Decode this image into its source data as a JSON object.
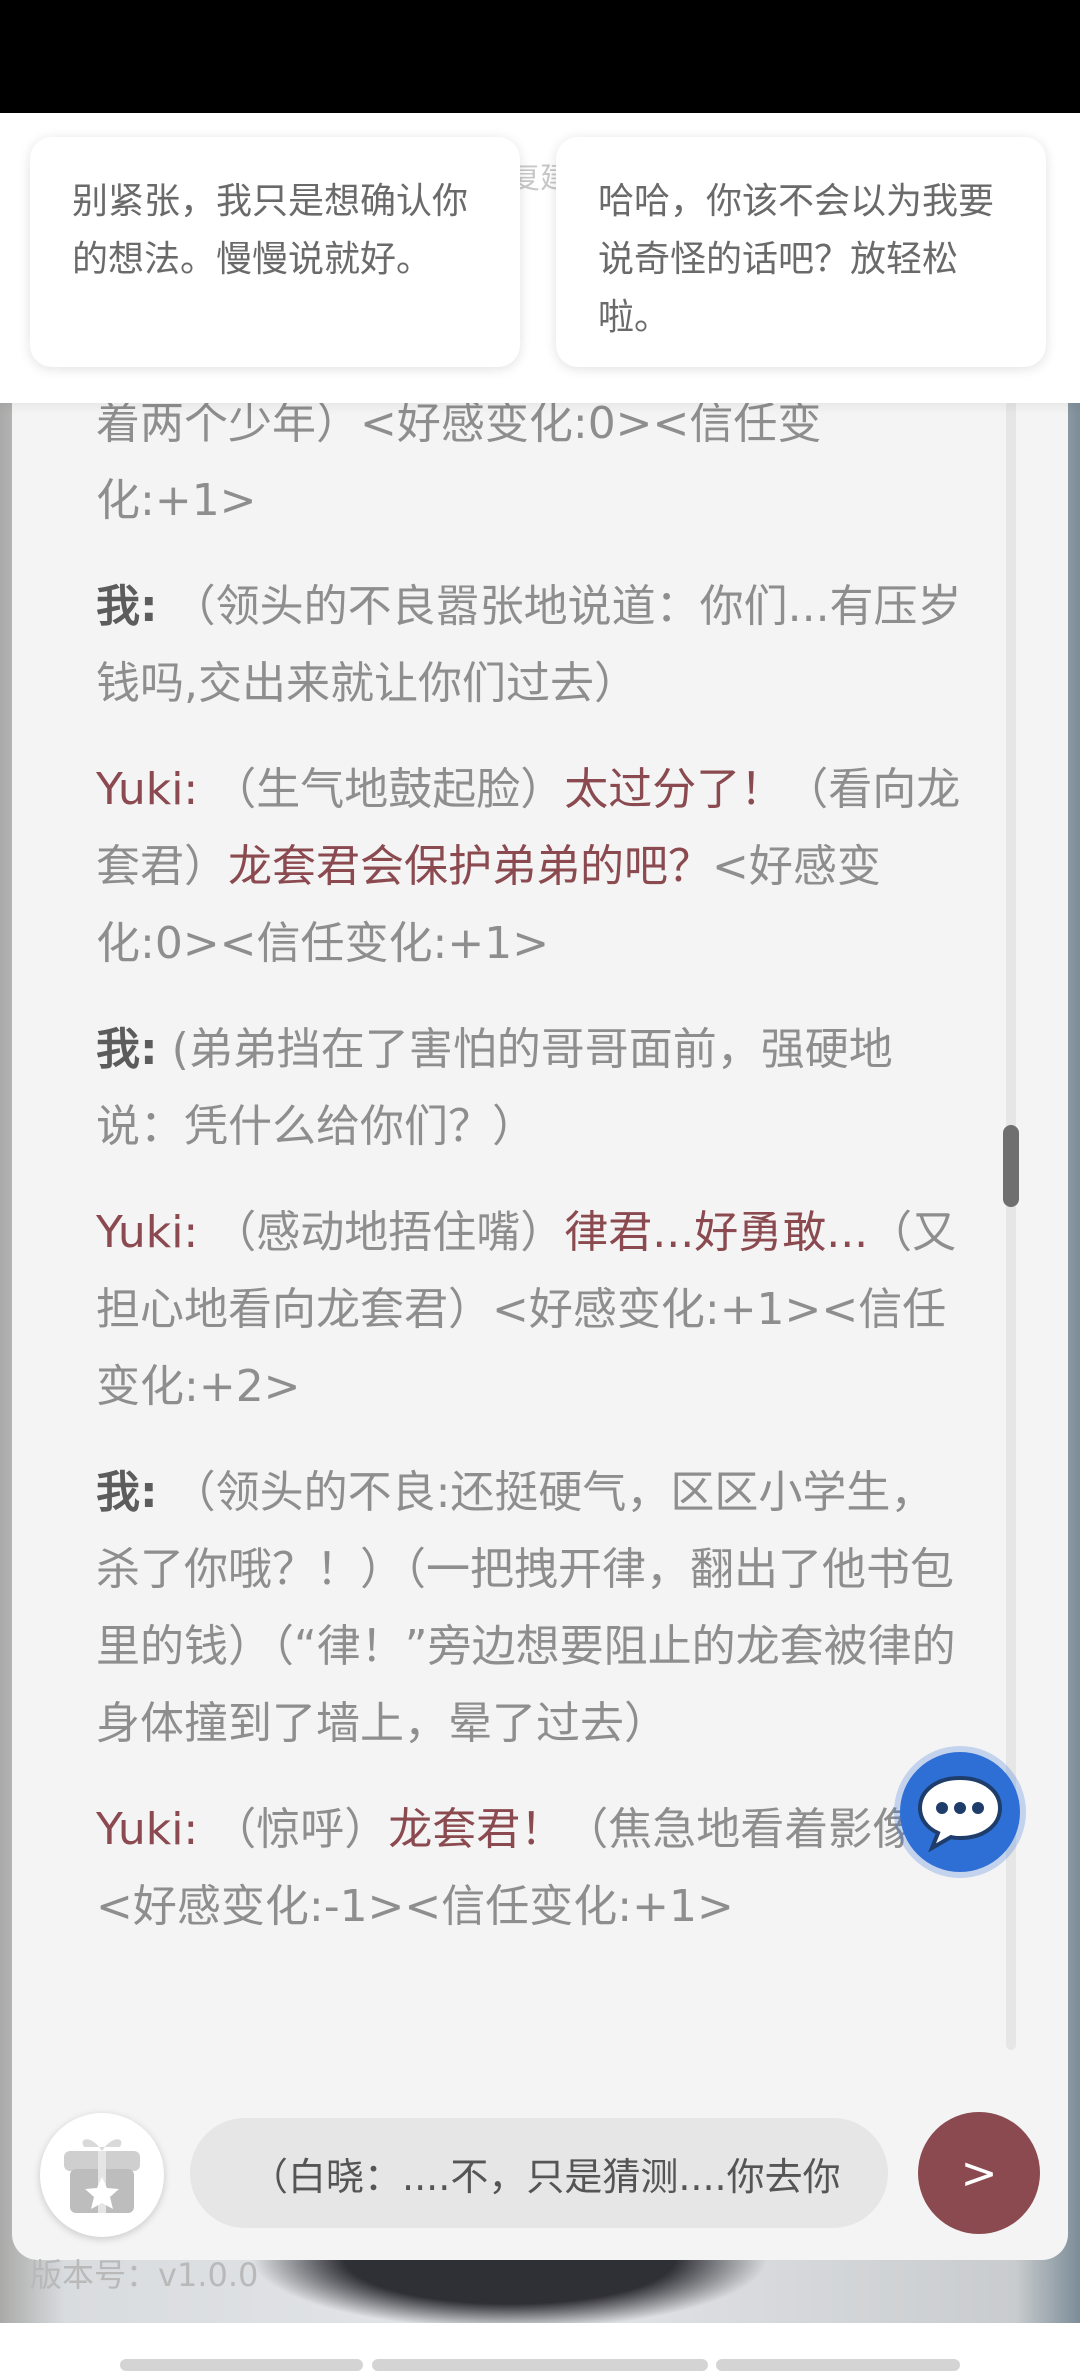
{
  "suggestions": {
    "title": "回复建议",
    "cards": [
      "别紧张，我只是想确认你的想法。慢慢说就好。",
      "哈哈，你该不会以为我要说奇怪的话吧？放轻松啦。"
    ]
  },
  "chat": {
    "m0": {
      "text": "着两个少年）<好感变化:0><信任变化:+1>"
    },
    "m1": {
      "speaker": "我:",
      "text": " （领头的不良嚣张地说道：你们...有压岁钱吗,交出来就让你们过去）"
    },
    "m2": {
      "speaker": "Yuki:",
      "a1": " （生气地鼓起脸）",
      "s1": "太过分了！",
      "a2": "（看向龙套君）",
      "s2": "龙套君会保护弟弟的吧？",
      "a3": "<好感变化:0><信任变化:+1>"
    },
    "m3": {
      "speaker": "我:",
      "text": " (弟弟挡在了害怕的哥哥面前，强硬地说：凭什么给你们？）"
    },
    "m4": {
      "speaker": "Yuki:",
      "a1": " （感动地捂住嘴）",
      "s1": "律君...好勇敢...",
      "a2": "（又担心地看向龙套君）<好感变化:+1><信任变化:+2>"
    },
    "m5": {
      "speaker": "我:",
      "text": " （领头的不良:还挺硬气，区区小学生，杀了你哦？！）（一把拽开律，翻出了他书包里的钱）（“律！”旁边想要阻止的龙套被律的身体撞到了墙上，晕了过去）"
    },
    "m6": {
      "speaker": "Yuki:",
      "a1": " （惊呼）",
      "s1": "龙套君！",
      "a2": "（焦急地看着影像）<好感变化:-1><信任变化:+1>"
    }
  },
  "composer": {
    "input_value": "（白晓：....不，只是猜测....你去你",
    "send_label": ">"
  },
  "footer": {
    "version": "版本号：v1.0.0"
  },
  "icons": {
    "float": "chat-bubble-icon",
    "gift": "gift-icon",
    "send": "send-icon"
  },
  "colors": {
    "accent": "#8a4a4f",
    "float_button": "#2e6fd6"
  }
}
